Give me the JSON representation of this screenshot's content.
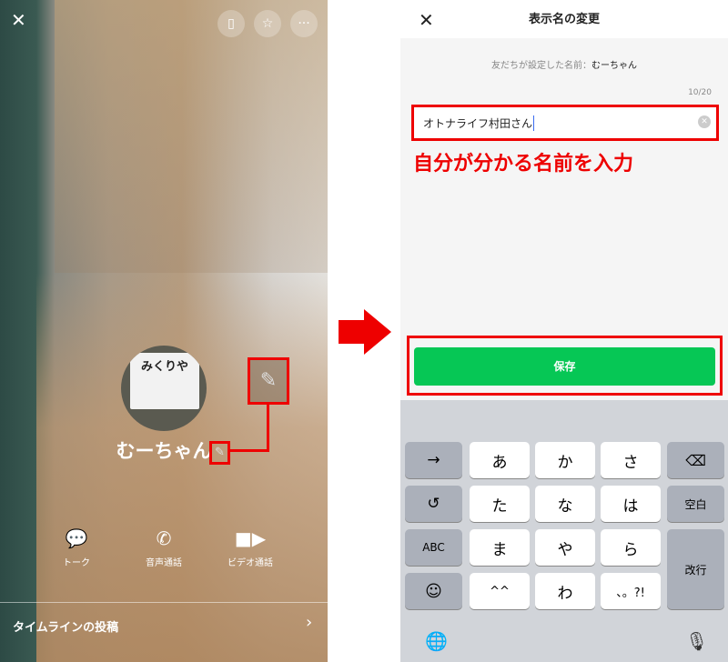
{
  "left": {
    "avatar_sign": "みくりや",
    "name": "むーちゃん",
    "actions": [
      {
        "label": "トーク",
        "icon": "chat-bubble-icon"
      },
      {
        "label": "音声通話",
        "icon": "phone-icon"
      },
      {
        "label": "ビデオ通話",
        "icon": "video-camera-icon"
      }
    ],
    "timeline_label": "タイムラインの投稿"
  },
  "right": {
    "title": "表示名の変更",
    "friend_set_label": "友だちが設定した名前：",
    "friend_set_name": "むーちゃん",
    "counter": "10/20",
    "input_value": "オトナライフ村田さん",
    "annotation": "自分が分かる名前を入力",
    "save_label": "保存",
    "keyboard": {
      "rows": [
        [
          "→",
          "あ",
          "か",
          "さ",
          "⌫"
        ],
        [
          "↺",
          "た",
          "な",
          "は",
          "空白"
        ],
        [
          "ABC",
          "ま",
          "や",
          "ら",
          "改行"
        ],
        [
          "☺",
          "^^",
          "わ",
          "、。?!"
        ]
      ]
    }
  },
  "colors": {
    "accent_green": "#06c755",
    "annotation_red": "#ee0000"
  }
}
